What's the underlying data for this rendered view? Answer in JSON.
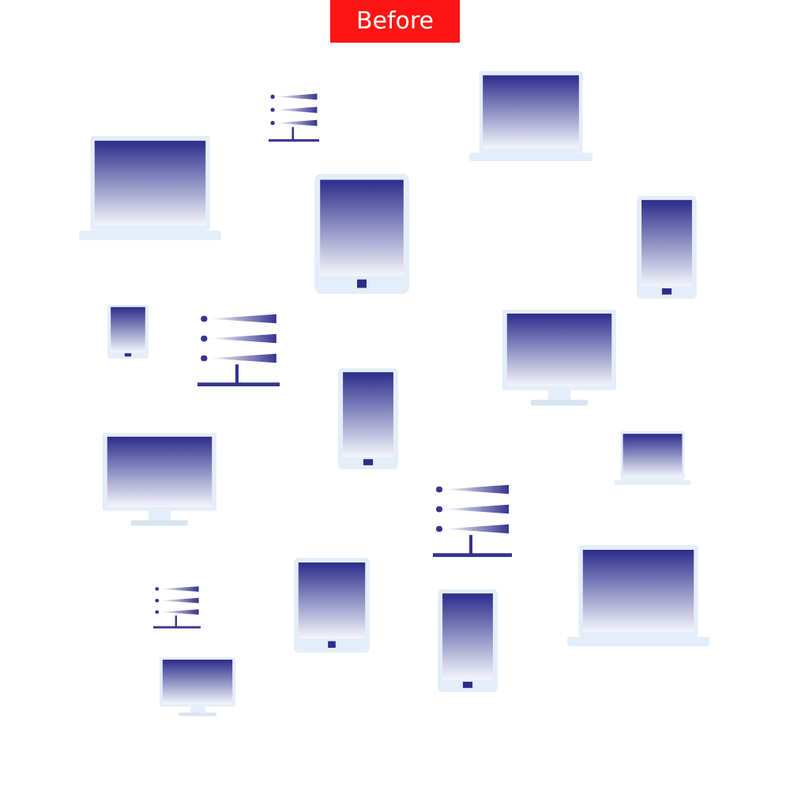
{
  "label": "Before",
  "devices": [
    {
      "kind": "server"
    },
    {
      "kind": "laptop"
    },
    {
      "kind": "laptop"
    },
    {
      "kind": "tablet"
    },
    {
      "kind": "phone"
    },
    {
      "kind": "phone"
    },
    {
      "kind": "server"
    },
    {
      "kind": "monitor"
    },
    {
      "kind": "phone"
    },
    {
      "kind": "monitor"
    },
    {
      "kind": "laptop"
    },
    {
      "kind": "server"
    },
    {
      "kind": "laptop"
    },
    {
      "kind": "server"
    },
    {
      "kind": "tablet"
    },
    {
      "kind": "phone"
    },
    {
      "kind": "monitor"
    }
  ]
}
